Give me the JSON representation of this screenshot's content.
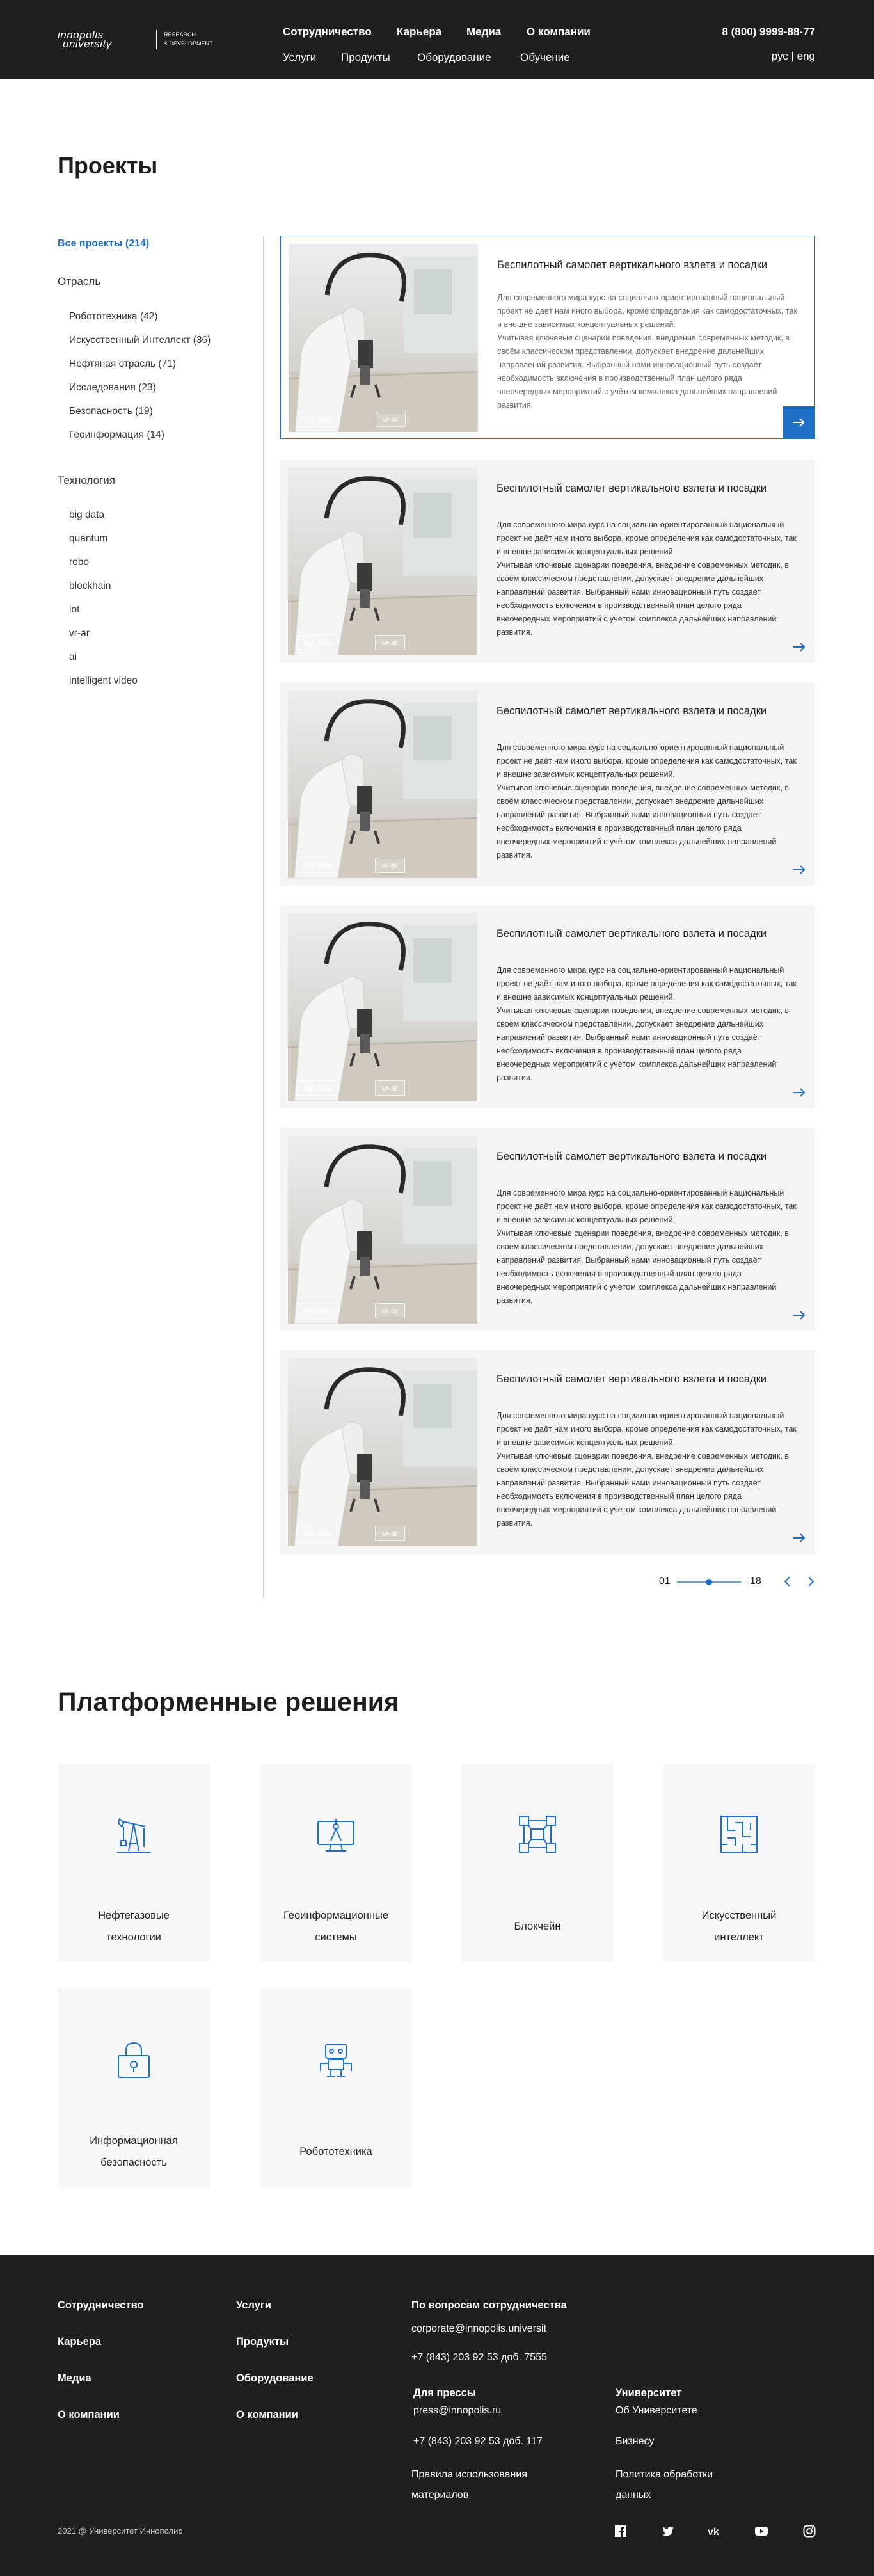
{
  "header": {
    "logo_line1": "innopolis",
    "logo_line2": "university",
    "logo_sub1": "RESEARCH",
    "logo_sub2": "& DEVELOPMENT",
    "nav_top": [
      "Сотрудничество",
      "Карьера",
      "Медиа",
      "О компании"
    ],
    "nav_bottom": [
      "Услуги",
      "Продукты",
      "Оборудование",
      "Обучение"
    ],
    "phone": "8 (800) 9999-88-77",
    "lang": "рус | eng"
  },
  "projects": {
    "title": "Проекты",
    "all": "Все проекты (214)",
    "industry_heading": "Отрасль",
    "industries": [
      "Робототехника (42)",
      "Искусственный Интеллект (36)",
      "Нефтяная отрасль (71)",
      "Исследования (23)",
      "Безопасность (19)",
      "Геоинформация (14)"
    ],
    "tech_heading": "Технология",
    "technologies": [
      "big data",
      "quantum",
      "robo",
      "blockhain",
      "iot",
      "vr-ar",
      "ai",
      "intelligent video"
    ],
    "cards": [
      {
        "title": "Беспилотный самолет вертикального взлета и посадки",
        "paras": [
          "Для современного мира курс на социально-ориентированный национальный проект не даёт нам иного выбора, кроме определения как самодостаточных, так и внешне зависимых концептуальных решений.",
          "Учитывая ключевые сценарии поведения, внедрение современных методик, в своём классическом представлении, допускает внедрение дальнейших направлений развития. Выбранный нами инновационный путь создаёт необходимость включения в производственный план целого ряда внеочередных мероприятий с учётом комплекса дальнейших направлений развития."
        ],
        "tags": [
          "big data",
          "vr-ar"
        ]
      },
      {
        "title": "Беспилотный самолет вертикального взлета и посадки",
        "paras": [
          "Для современного мира курс на социально-ориентированный национальный проект не даёт нам иного выбора, кроме определения как самодостаточных, так и внешне зависимых концептуальных решений.",
          "Учитывая ключевые сценарии поведения, внедрение современных методик, в своём классическом представлении, допускает внедрение дальнейших направлений развития. Выбранный нами инновационный путь создаёт необходимость включения в производственный план целого ряда внеочередных мероприятий с учётом комплекса дальнейших направлений развития."
        ],
        "tags": [
          "big data",
          "vr-ar"
        ]
      },
      {
        "title": "Беспилотный самолет вертикального взлета и посадки",
        "paras": [
          "Для современного мира курс на социально-ориентированный национальный проект не даёт нам иного выбора, кроме определения как самодостаточных, так и внешне зависимых концептуальных решений.",
          "Учитывая ключевые сценарии поведения, внедрение современных методик, в своём классическом представлении, допускает внедрение дальнейших направлений развития. Выбранный нами инновационный путь создаёт необходимость включения в производственный план целого ряда внеочередных мероприятий с учётом комплекса дальнейших направлений развития."
        ],
        "tags": [
          "big data",
          "vr-ar"
        ]
      },
      {
        "title": "Беспилотный самолет вертикального взлета и посадки",
        "paras": [
          "Для современного мира курс на социально-ориентированный национальный проект не даёт нам иного выбора, кроме определения как самодостаточных, так и внешне зависимых концептуальных решений.",
          "Учитывая ключевые сценарии поведения, внедрение современных методик, в своём классическом представлении, допускает внедрение дальнейших направлений развития. Выбранный нами инновационный путь создаёт необходимость включения в производственный план целого ряда внеочередных мероприятий с учётом комплекса дальнейших направлений развития."
        ],
        "tags": [
          "big data",
          "vr-ar"
        ]
      },
      {
        "title": "Беспилотный самолет вертикального взлета и посадки",
        "paras": [
          "Для современного мира курс на социально-ориентированный национальный проект не даёт нам иного выбора, кроме определения как самодостаточных, так и внешне зависимых концептуальных решений.",
          "Учитывая ключевые сценарии поведения, внедрение современных методик, в своём классическом представлении, допускает внедрение дальнейших направлений развития. Выбранный нами инновационный путь создаёт необходимость включения в производственный план целого ряда внеочередных мероприятий с учётом комплекса дальнейших направлений развития."
        ],
        "tags": [
          "big data",
          "vr-ar"
        ]
      },
      {
        "title": "Беспилотный самолет вертикального взлета и посадки",
        "paras": [
          "Для современного мира курс на социально-ориентированный национальный проект не даёт нам иного выбора, кроме определения как самодостаточных, так и внешне зависимых концептуальных решений.",
          "Учитывая ключевые сценарии поведения, внедрение современных методик, в своём классическом представлении, допускает внедрение дальнейших направлений развития. Выбранный нами инновационный путь создаёт необходимость включения в производственный план целого ряда внеочередных мероприятий с учётом комплекса дальнейших направлений развития."
        ],
        "tags": [
          "big data",
          "vr-ar"
        ]
      }
    ],
    "pager": {
      "first": "01",
      "last": "18",
      "position": 0.5
    }
  },
  "platforms": {
    "title": "Платформенные решения",
    "items": [
      {
        "label1": "Нефтегазовые",
        "label2": "технологии",
        "icon": "oil-pump-icon"
      },
      {
        "label1": "Геоинформационные",
        "label2": "системы",
        "icon": "workstation-icon"
      },
      {
        "label1": "Блокчейн",
        "label2": "",
        "icon": "blockchain-icon"
      },
      {
        "label1": "Искусственный",
        "label2": "интеллект",
        "icon": "maze-icon"
      },
      {
        "label1": "Информационная",
        "label2": "безопасность",
        "icon": "lock-icon"
      },
      {
        "label1": "Робототехника",
        "label2": "",
        "icon": "robot-icon"
      }
    ]
  },
  "footer": {
    "col1": [
      "Сотрудничество",
      "Карьера",
      "Медиа",
      "О компании"
    ],
    "col2": [
      "Услуги",
      "Продукты",
      "Оборудование",
      "О компании"
    ],
    "contact_heading": "По вопросам сотрудничества",
    "contact_email": "corporate@innopolis.universit",
    "contact_phone": "+7 (843) 203 92 53 доб. 7555",
    "press_heading": "Для прессы",
    "press_email": "press@innopolis.ru",
    "press_phone": "+7 (843) 203 92 53 доб. 117",
    "terms1": "Правила использования",
    "terms2": "материалов",
    "univ_heading": "Университет",
    "univ_links": [
      "Об Университете",
      "Бизнесу"
    ],
    "privacy1": "Политика обработки",
    "privacy2": "данных",
    "copyright": "2021 @ Университет Иннополис",
    "social": [
      "facebook-icon",
      "twitter-icon",
      "vk-icon",
      "youtube-icon",
      "instagram-icon"
    ]
  },
  "colors": {
    "accent": "#1f6fc6",
    "dark": "#1f1f1f",
    "card_bg": "#f4f4f4",
    "tile_bg": "#f6f7f9"
  }
}
